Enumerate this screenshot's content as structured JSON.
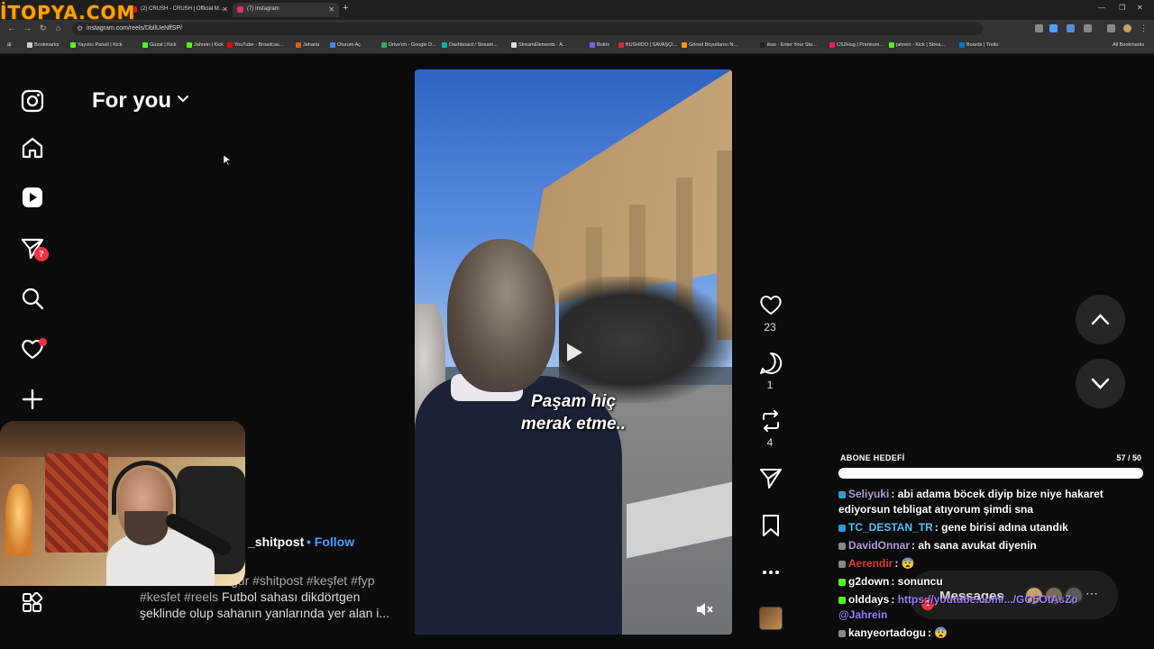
{
  "browser": {
    "watermark": "İTOPYA.COM",
    "tabs": [
      {
        "title": "(2) CRUSH - CRUSH | Official M...",
        "favicon_color": "#ff0033",
        "active": false
      },
      {
        "title": "(7) Instagram",
        "favicon_color": "#e1306c",
        "active": true
      }
    ],
    "url": "instagram.com/reels/DbllUeNffSP/",
    "bookmarks": [
      {
        "label": "Bookmarks",
        "color": "#cccccc"
      },
      {
        "label": "Yayıncı Paneli | Kick",
        "color": "#53fc18"
      },
      {
        "label": "Güzat | Kick",
        "color": "#53fc18"
      },
      {
        "label": "Jahrein | Kick",
        "color": "#53fc18"
      },
      {
        "label": "YouTube - Broadcas...",
        "color": "#ff0000"
      },
      {
        "label": "Jaharia",
        "color": "#e05a2a"
      },
      {
        "label": "Oturum Aç",
        "color": "#4285f4"
      },
      {
        "label": "Drive'ım - Google D...",
        "color": "#34a853"
      },
      {
        "label": "Dashboard / Stream...",
        "color": "#00b4a0"
      },
      {
        "label": "StreamElements - A...",
        "color": "#dddddd"
      },
      {
        "label": "Botrix",
        "color": "#7b5cff"
      },
      {
        "label": "BUSHIDO | SAVAŞÇI...",
        "color": "#d32f2f"
      },
      {
        "label": "Görsel Boyutlarını N...",
        "color": "#ff9800"
      },
      {
        "label": "ikas - Enter Your Sto...",
        "color": "#222222"
      },
      {
        "label": "CS2Hug | Premium...",
        "color": "#e91e63"
      },
      {
        "label": "jahrein - Kick | Strea...",
        "color": "#53fc18"
      },
      {
        "label": "Boards | Trello",
        "color": "#0079bf"
      }
    ],
    "all_bookmarks": "All Bookmarks"
  },
  "sidebar": {
    "icons": [
      "instagram-icon",
      "home-icon",
      "reels-icon",
      "direct-icon",
      "search-icon",
      "notifications-icon",
      "create-icon",
      "more-icon"
    ],
    "direct_badge": "7"
  },
  "feed": {
    "title": "For you"
  },
  "reel": {
    "caption_line1": "Paşam hiç",
    "caption_line2": "merak etme..",
    "username": "_shitpost",
    "follow": "• Follow",
    "tags_line1": "gur #shitpost #keşfet #fyp",
    "tags_line2": "#kesfet #reels",
    "desc_line2": " Futbol sahası dikdörtgen",
    "desc_line3": "şeklinde olup sahanın yanlarında yer alan i...",
    "likes": "23",
    "comments": "1",
    "reposts": "4"
  },
  "stream_overlay": {
    "goal_label": "ABONE HEDEFİ",
    "goal_count": "57 / 50",
    "goal_progress": 1.0,
    "chat": [
      {
        "user": "Seliyuki",
        "user_color": "#b39ddb",
        "text": ": abi adama böcek diyip bize niye hakaret ediyorsun tebligat atıyorum şimdi sna",
        "badge_color": "#2e9bd6"
      },
      {
        "user": "TC_DESTAN_TR",
        "user_color": "#4fc3f7",
        "text": ": gene birisi adına utandık",
        "badge_color": "#2e9bd6"
      },
      {
        "user": "DavidOnnar",
        "user_color": "#b39ddb",
        "text": ": ah sana avukat diyenin",
        "badge_color": "#888888"
      },
      {
        "user": "Aerendir",
        "user_color": "#e53935",
        "text": ": 😨",
        "badge_color": "#888888"
      },
      {
        "user": "g2down",
        "user_color": "#ffffff",
        "text": ": sonuncu",
        "badge_color": "#53fc18"
      },
      {
        "user": "olddays",
        "user_color": "#ffffff",
        "text": ": ",
        "link": "https://youtube.com/.../GO5OtAsZo @Jahrein",
        "badge_color": "#53fc18"
      },
      {
        "user": "kanyeortadogu",
        "user_color": "#ffffff",
        "text": ": 😨",
        "badge_color": "#888888"
      }
    ]
  },
  "messages": {
    "label": "Messages",
    "badge": "1"
  }
}
